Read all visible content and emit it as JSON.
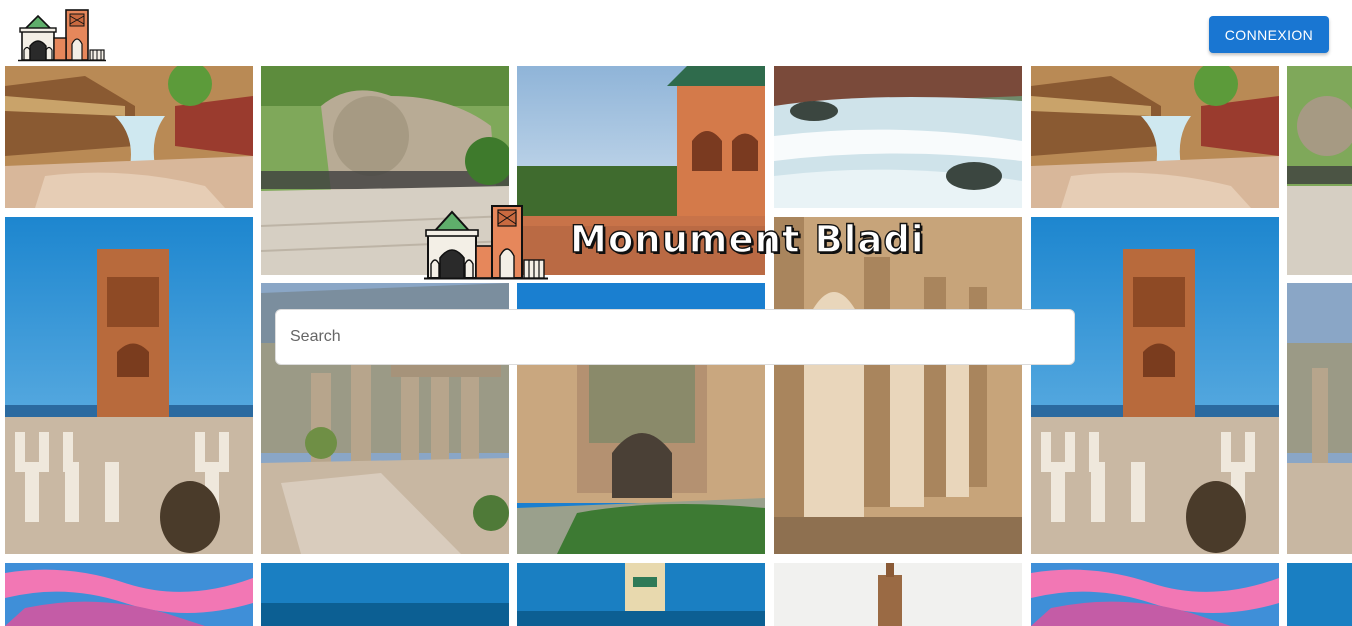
{
  "header": {
    "logo_icon": "moroccan-monument-logo-icon",
    "login_label": "CONNEXION"
  },
  "hero": {
    "title": "Monument Bladi",
    "logo_icon": "moroccan-monument-logo-icon"
  },
  "search": {
    "placeholder": "Search",
    "value": ""
  },
  "gallery": {
    "photos": [
      "waterfall-village",
      "stone-lion-statue",
      "palace-pavilion-pool",
      "river-waterfall",
      "hassan-tower",
      "volubilis-ruins",
      "bab-mansour-gate",
      "roman-aqueduct",
      "sunset-sky",
      "hassan-ii-minaret",
      "koutoubia-minaret"
    ]
  },
  "colors": {
    "accent": "#1976d2",
    "title_fill": "#ffffff",
    "title_outline": "#111111"
  }
}
